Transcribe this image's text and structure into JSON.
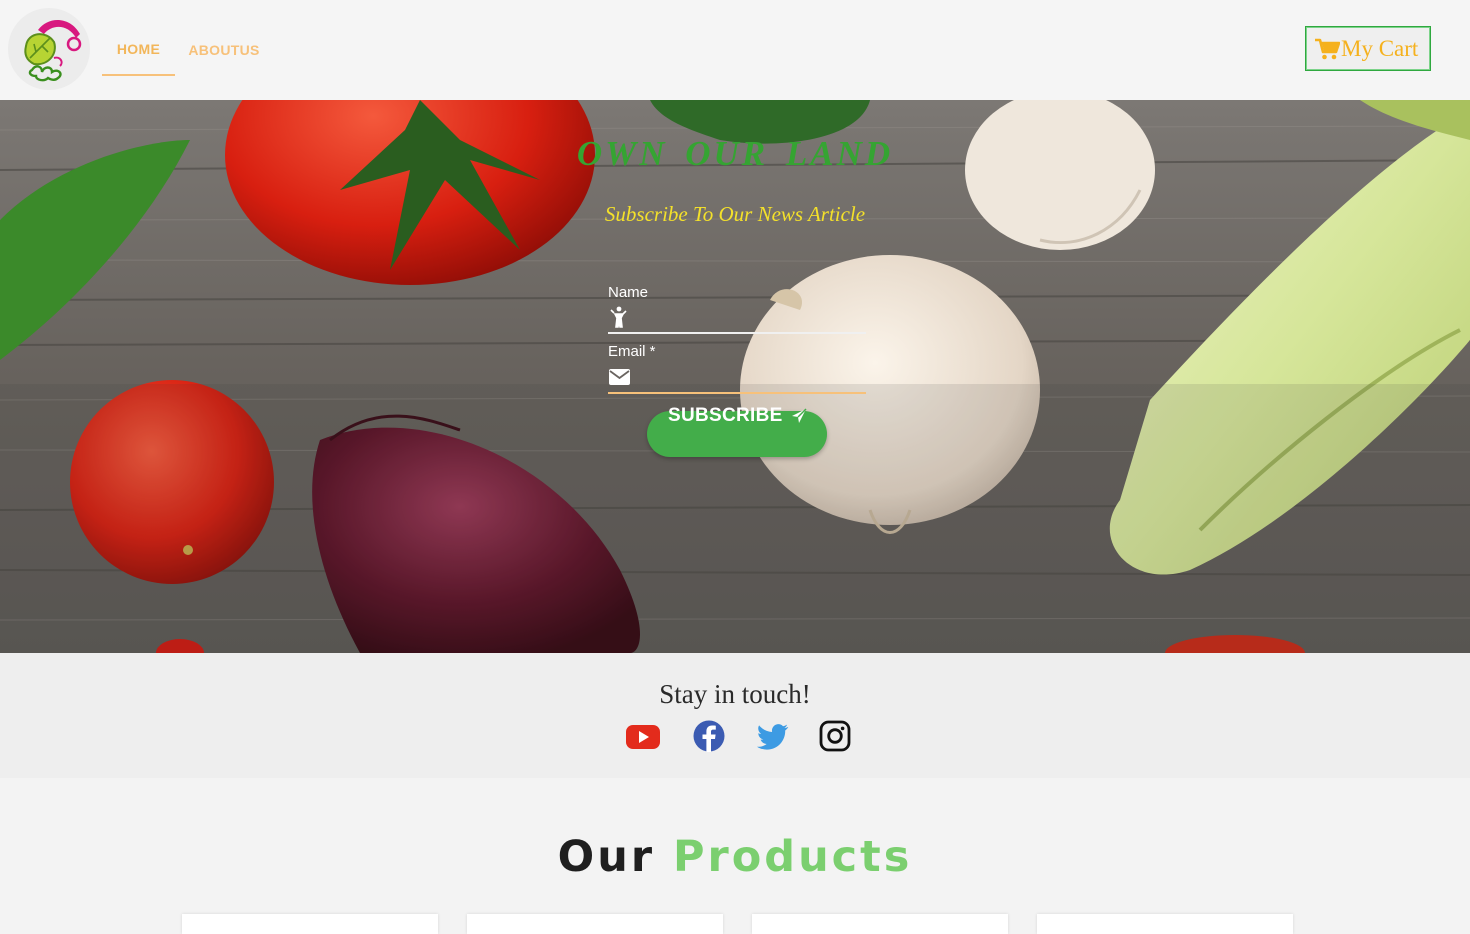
{
  "header": {
    "logo_icon": "leaf-radish-logo-icon",
    "tabs": [
      {
        "label": "HOME",
        "active": true
      },
      {
        "label": "ABOUTUS",
        "active": false
      }
    ],
    "cart": {
      "label": "My Cart",
      "icon": "cart-icon",
      "color": "#f5b11d",
      "border_color": "#2fa83f"
    }
  },
  "hero": {
    "title": "OWN OUR LAND",
    "subtitle": "Subscribe To Our News Article",
    "form": {
      "name_label": "Name",
      "name_icon": "person-icon",
      "email_label": "Email *",
      "email_icon": "mail-icon",
      "button_label": "SUBSCRIBE",
      "button_icon": "send-icon",
      "button_color": "#43ad4a"
    },
    "title_color": "#35a432",
    "subtitle_color": "#f4e12a"
  },
  "touch": {
    "title": "Stay in touch!",
    "social": [
      "youtube-icon",
      "facebook-icon",
      "twitter-icon",
      "instagram-icon"
    ]
  },
  "products": {
    "title_word1": "Our",
    "title_word2": "Products",
    "accent_color": "#7bcf6f"
  }
}
